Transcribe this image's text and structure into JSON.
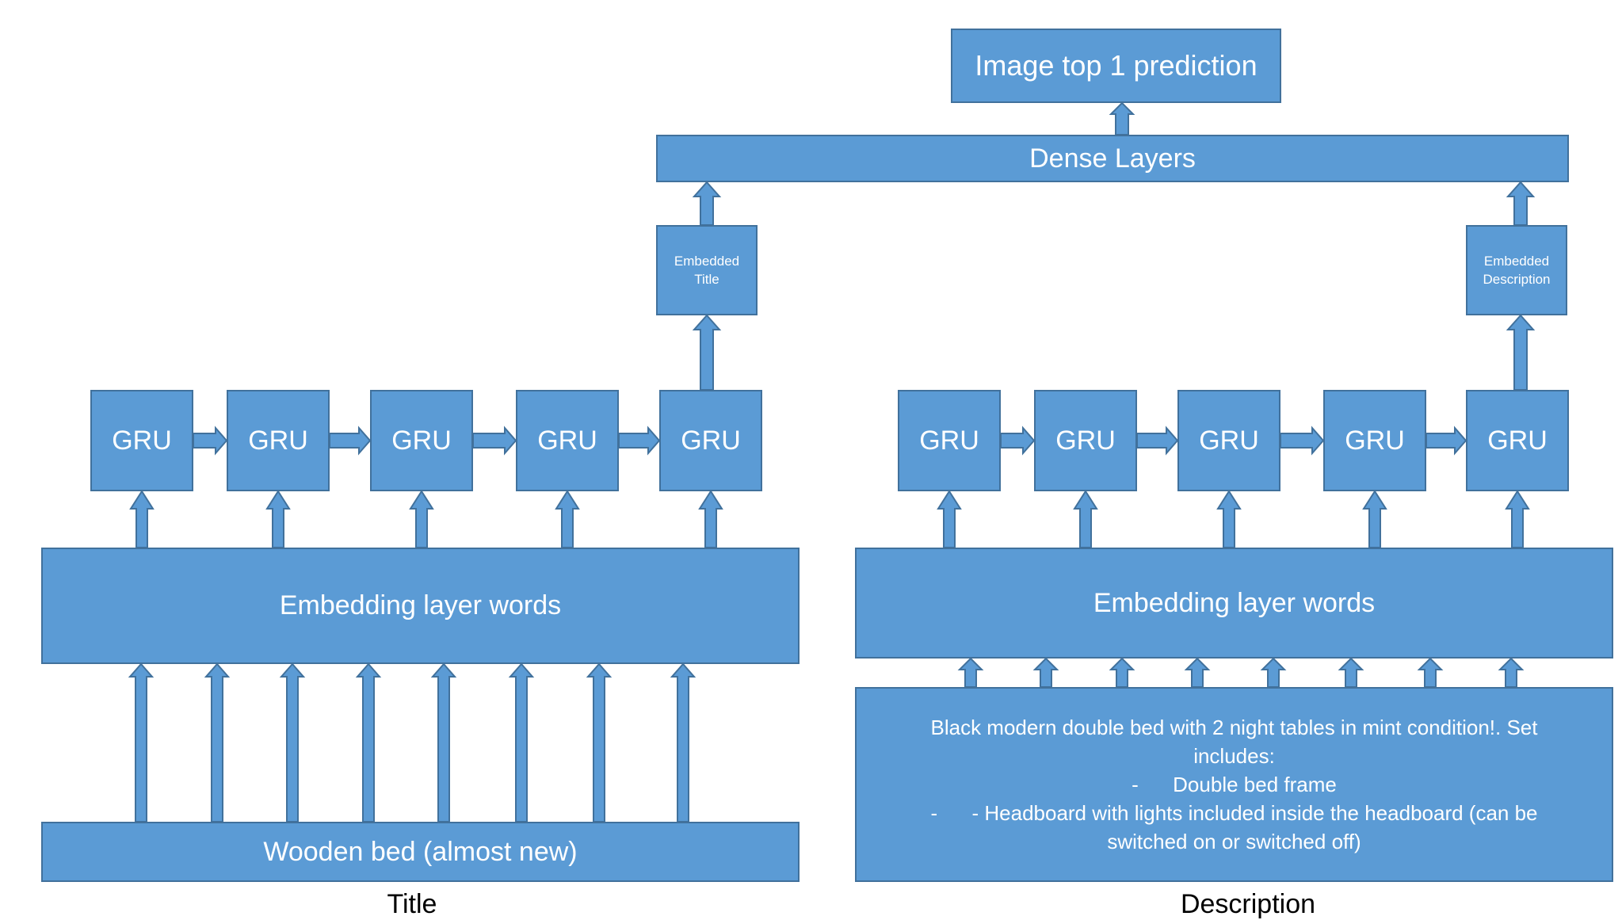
{
  "colors": {
    "box_fill": "#5B9BD5",
    "box_stroke": "#41719C",
    "text_on_box": "#FFFFFF",
    "caption": "#000000"
  },
  "top": {
    "prediction_label": "Image top 1 prediction",
    "dense_label": "Dense Layers"
  },
  "title_branch": {
    "caption": "Title",
    "embedded_label_line1": "Embedded",
    "embedded_label_line2": "Title",
    "gru_labels": [
      "GRU",
      "GRU",
      "GRU",
      "GRU",
      "GRU"
    ],
    "embedding_label": "Embedding layer words",
    "input_text": "Wooden bed (almost new)",
    "input_arrow_count": 8
  },
  "description_branch": {
    "caption": "Description",
    "embedded_label_line1": "Embedded",
    "embedded_label_line2": "Description",
    "gru_labels": [
      "GRU",
      "GRU",
      "GRU",
      "GRU",
      "GRU"
    ],
    "embedding_label": "Embedding layer words",
    "input_lines": [
      "Black modern double bed with 2 night tables in mint condition!. Set",
      "includes:",
      "-      Double bed frame",
      "-      - Headboard with lights included inside the headboard (can be",
      "switched on or switched off)"
    ],
    "input_arrow_count": 8
  }
}
